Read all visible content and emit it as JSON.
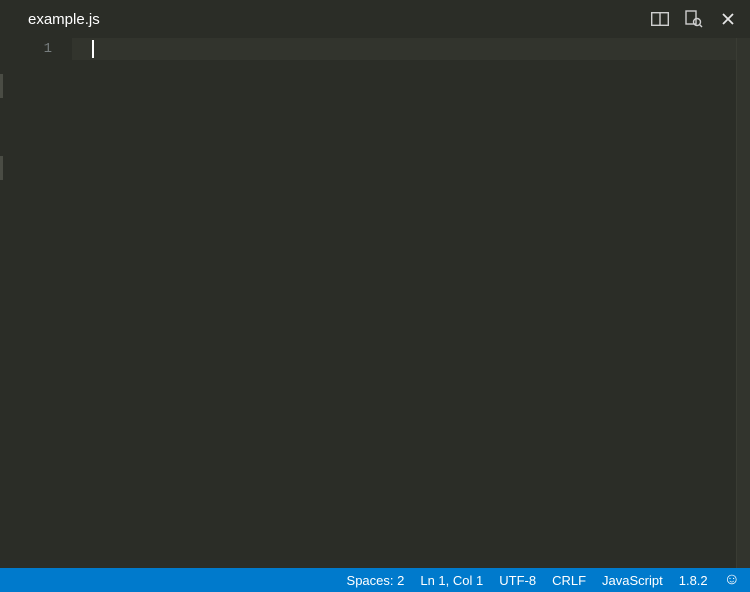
{
  "tabs": {
    "active": "example.js"
  },
  "tab_actions": {
    "split": "split-editor",
    "peek": "show-source",
    "close": "close"
  },
  "editor": {
    "gutter_first": "1"
  },
  "status": {
    "indent": "Spaces: 2",
    "cursor": "Ln 1, Col 1",
    "encoding": "UTF-8",
    "eol": "CRLF",
    "language": "JavaScript",
    "version": "1.8.2",
    "feedback_glyph": "☺"
  },
  "colors": {
    "statusbar": "#007acc",
    "editor_bg": "#2b2d27",
    "current_line": "#32342d"
  }
}
